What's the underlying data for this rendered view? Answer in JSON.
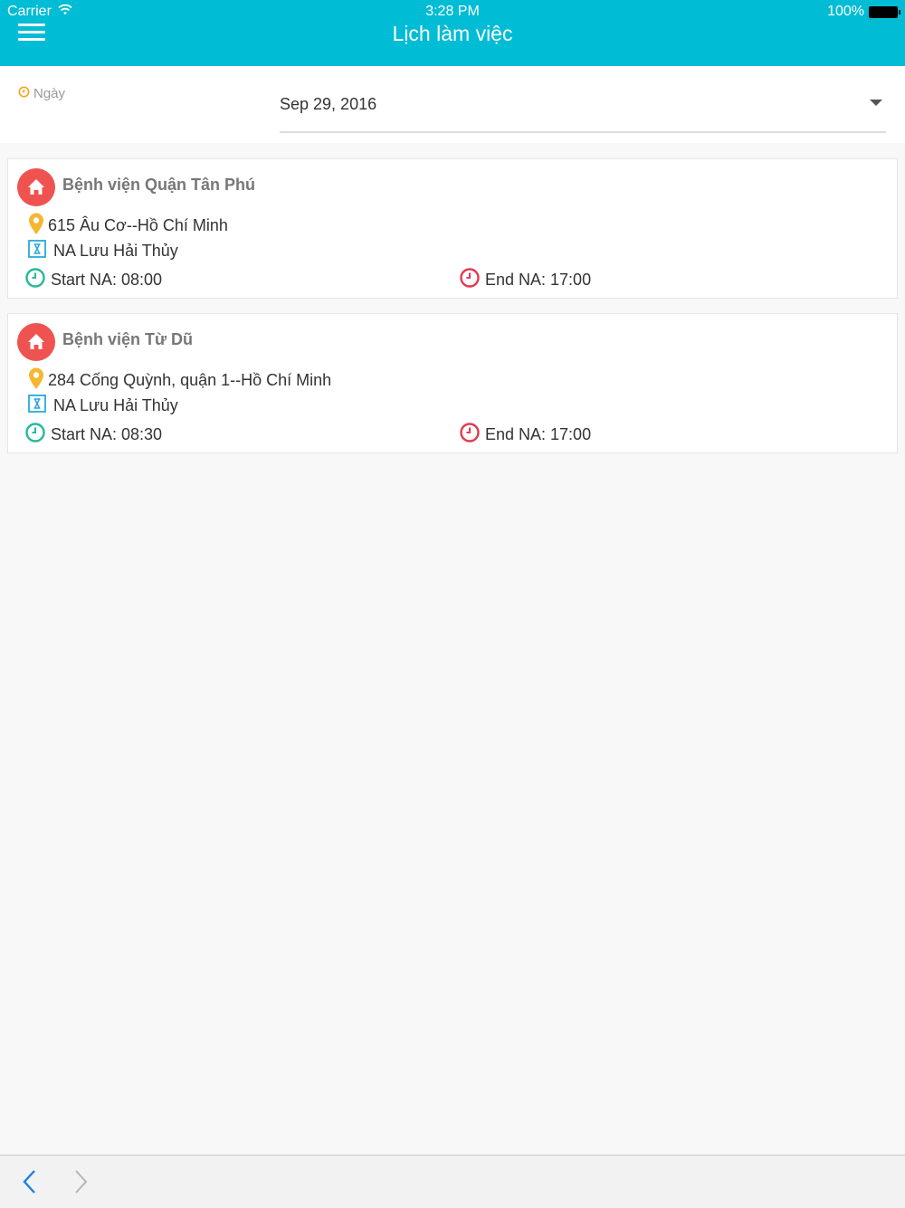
{
  "status_bar": {
    "carrier": "Carrier",
    "time": "3:28 PM",
    "battery": "100%"
  },
  "header": {
    "title": "Lịch làm việc",
    "menu_icon": "hamburger-menu-icon"
  },
  "date_filter": {
    "label": "Ngày",
    "value": "Sep 29, 2016"
  },
  "schedule": [
    {
      "hospital": "Bệnh viện Quận Tân Phú",
      "address": "615 Âu Cơ--Hồ Chí Minh",
      "person": "NA Lưu Hải Thủy",
      "start": "Start NA: 08:00",
      "end": "End NA: 17:00"
    },
    {
      "hospital": "Bệnh viện Từ Dũ",
      "address": "284 Cống Quỳnh, quận 1--Hồ Chí Minh",
      "person": "NA Lưu Hải Thủy",
      "start": "Start NA: 08:30",
      "end": "End NA: 17:00"
    }
  ],
  "colors": {
    "header": "#00bcd4",
    "home_badge": "#ef5350",
    "start_clock": "#26b99a",
    "end_clock": "#e53950",
    "pin": "#f5b731",
    "person_icon": "#29a9d8",
    "nav_back": "#1a7ee8"
  }
}
